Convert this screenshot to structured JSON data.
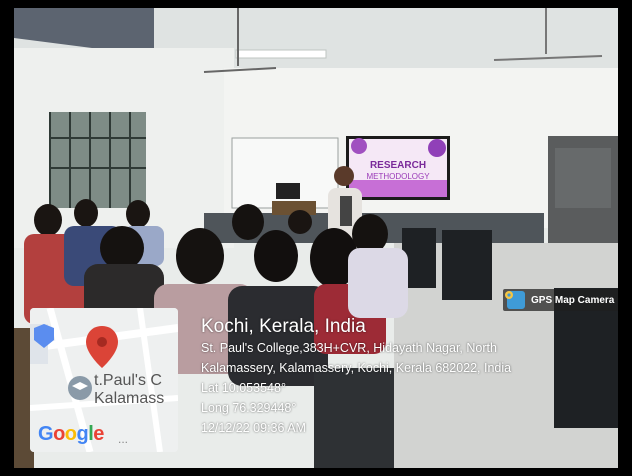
{
  "badge": {
    "label": "GPS Map Camera",
    "icon": "camera-pin-icon"
  },
  "location": {
    "title": "Kochi, Kerala, India",
    "address_line1": "St. Paul's College,383H+CVR, Hidayath Nagar, North",
    "address_line2": "Kalamassery, Kalamassery, Kochi, Kerala 682022, India",
    "lat": "Lat 10.053548°",
    "long": "Long 76.329448°",
    "datetime": "12/12/22 09:36 AM"
  },
  "map": {
    "place_label_1": "t.Paul's C",
    "place_label_2": "Kalamass",
    "logo": [
      "G",
      "o",
      "o",
      "g",
      "l",
      "e"
    ],
    "logo_suffix": "...",
    "pin_color": "#db4437",
    "logo_colors": [
      "#4285f4",
      "#ea4335",
      "#fbbc05",
      "#4285f4",
      "#34a853",
      "#ea4335"
    ]
  },
  "slide": {
    "line1": "RESEARCH",
    "line2": "METHODOLOGY"
  }
}
